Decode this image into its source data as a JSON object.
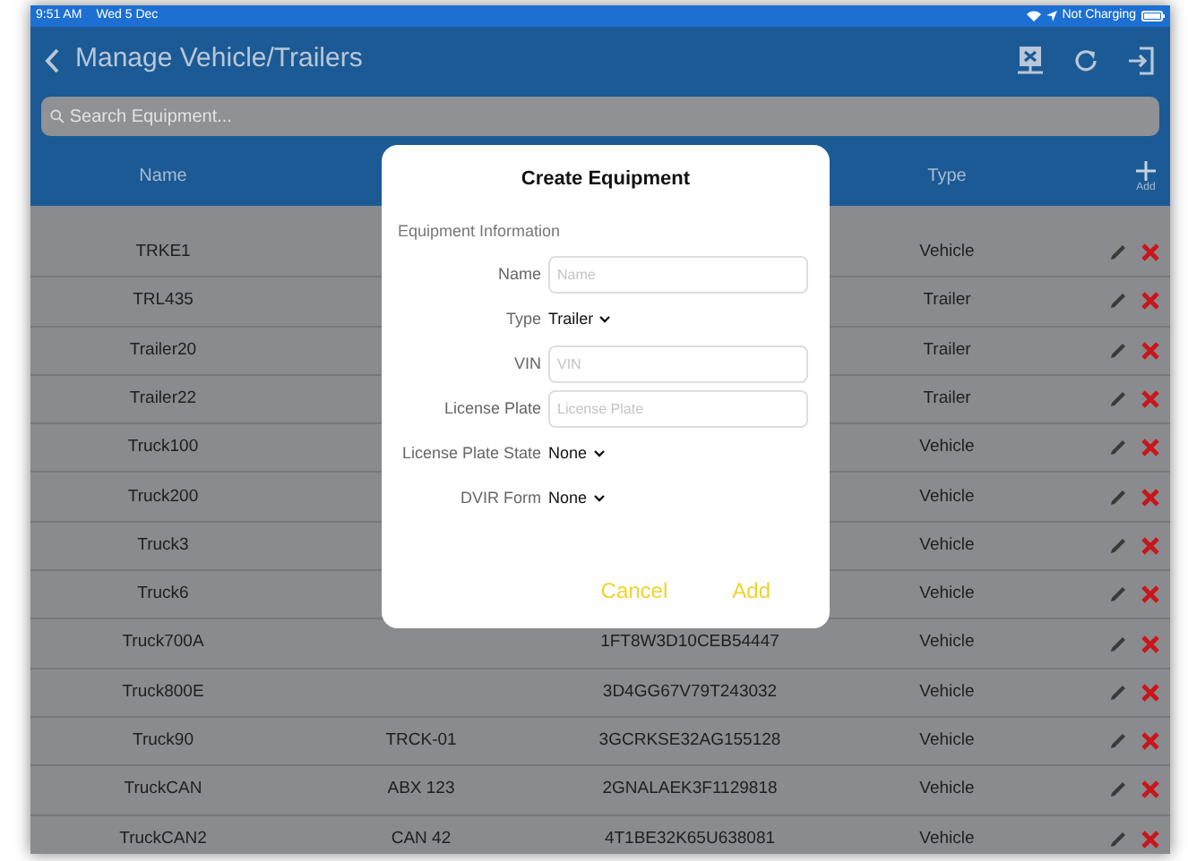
{
  "status_bar": {
    "time": "9:51 AM",
    "date": "Wed 5 Dec",
    "battery_text": "Not Charging"
  },
  "nav_bar": {
    "back_label": "Manage Vehicle/Trailers"
  },
  "search": {
    "placeholder": "Search Equipment..."
  },
  "table": {
    "columns": [
      {
        "label": "Name"
      },
      {
        "label": "Type"
      }
    ],
    "add_label": "Add",
    "rows": [
      {
        "name": "TRKE1",
        "column_2": "",
        "column_3": "",
        "type": "Vehicle"
      },
      {
        "name": "TRL435",
        "column_2": "",
        "column_3": "",
        "type": "Trailer"
      },
      {
        "name": "Trailer20",
        "column_2": "",
        "column_3": "",
        "type": "Trailer"
      },
      {
        "name": "Trailer22",
        "column_2": "",
        "column_3": "",
        "type": "Trailer"
      },
      {
        "name": "Truck100",
        "column_2": "",
        "column_3": "",
        "type": "Vehicle"
      },
      {
        "name": "Truck200",
        "column_2": "",
        "column_3": "",
        "type": "Vehicle"
      },
      {
        "name": "Truck3",
        "column_2": "",
        "column_3": "",
        "type": "Vehicle"
      },
      {
        "name": "Truck6",
        "column_2": "",
        "column_3": "",
        "type": "Vehicle"
      },
      {
        "name": "Truck700A",
        "column_2": "",
        "column_3": "1FT8W3D10CEB54447",
        "type": "Vehicle"
      },
      {
        "name": "Truck800E",
        "column_2": "",
        "column_3": "3D4GG67V79T243032",
        "type": "Vehicle"
      },
      {
        "name": "Truck90",
        "column_2": "TRCK-01",
        "column_3": "3GCRKSE32AG155128",
        "type": "Vehicle"
      },
      {
        "name": "TruckCAN",
        "column_2": "ABX 123",
        "column_3": "2GNALAEK3F1129818",
        "type": "Vehicle"
      },
      {
        "name": "TruckCAN2",
        "column_2": "CAN 42",
        "column_3": "4T1BE32K65U638081",
        "type": "Vehicle"
      }
    ]
  },
  "dialog": {
    "title": "Create Equipment",
    "section": "Equipment Information",
    "fields": [
      {
        "kind": "text",
        "label": "Name",
        "placeholder": "Name"
      },
      {
        "kind": "select",
        "label": "Type",
        "value": "Trailer"
      },
      {
        "kind": "text",
        "label": "VIN",
        "placeholder": "VIN"
      },
      {
        "kind": "text",
        "label": "License Plate",
        "placeholder": "License Plate"
      },
      {
        "kind": "select",
        "label": "License Plate State",
        "value": "None"
      },
      {
        "kind": "select",
        "label": "DVIR Form",
        "value": "None"
      }
    ],
    "buttons": [
      "Cancel",
      "Add"
    ]
  }
}
